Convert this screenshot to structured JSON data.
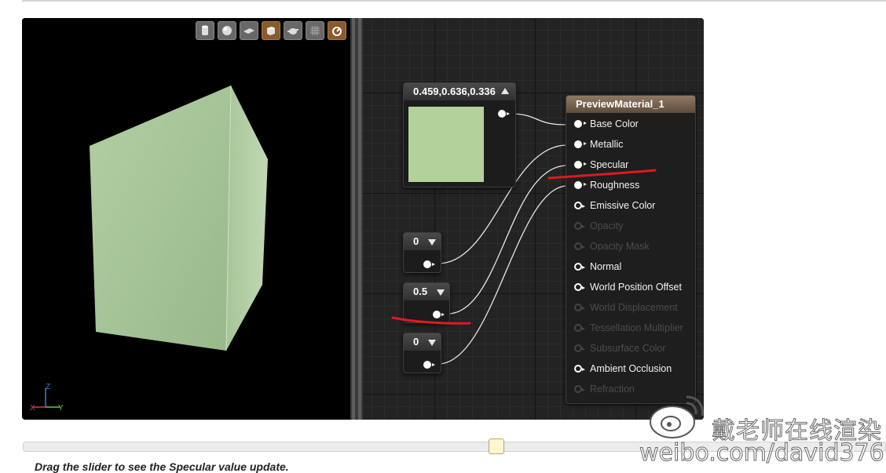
{
  "toolbar": {
    "icons": [
      "cylinder-preview-icon",
      "sphere-preview-icon",
      "plane-preview-icon",
      "cube-preview-icon",
      "teapot-preview-icon",
      "grid-icon",
      "realtime-icon"
    ]
  },
  "axis": {
    "x": "X",
    "y": "Y",
    "z": "Z"
  },
  "constant3": {
    "value": "0.459,0.636,0.336",
    "color": "#b3d19b"
  },
  "constant_metallic": {
    "value": "0"
  },
  "constant_specular": {
    "value": "0.5"
  },
  "constant_roughness": {
    "value": "0"
  },
  "material": {
    "title": "PreviewMaterial_1",
    "inputs": [
      {
        "label": "Base Color",
        "state": "connected"
      },
      {
        "label": "Metallic",
        "state": "connected"
      },
      {
        "label": "Specular",
        "state": "connected"
      },
      {
        "label": "Roughness",
        "state": "connected"
      },
      {
        "label": "Emissive Color",
        "state": "open"
      },
      {
        "label": "Opacity",
        "state": "disabled"
      },
      {
        "label": "Opacity Mask",
        "state": "disabled"
      },
      {
        "label": "Normal",
        "state": "open"
      },
      {
        "label": "World Position Offset",
        "state": "open"
      },
      {
        "label": "World Displacement",
        "state": "disabled"
      },
      {
        "label": "Tessellation Multiplier",
        "state": "disabled"
      },
      {
        "label": "Subsurface Color",
        "state": "disabled"
      },
      {
        "label": "Ambient Occlusion",
        "state": "open"
      },
      {
        "label": "Refraction",
        "state": "disabled"
      }
    ]
  },
  "slider": {
    "position_fraction": 0.54
  },
  "caption": "Drag the slider to see the Specular value update.",
  "watermark": {
    "cn": "戴老师在线渲染",
    "url": "weibo.com/david376"
  },
  "colors": {
    "accent_red": "#e0191f",
    "cube": "#a8c79a"
  }
}
